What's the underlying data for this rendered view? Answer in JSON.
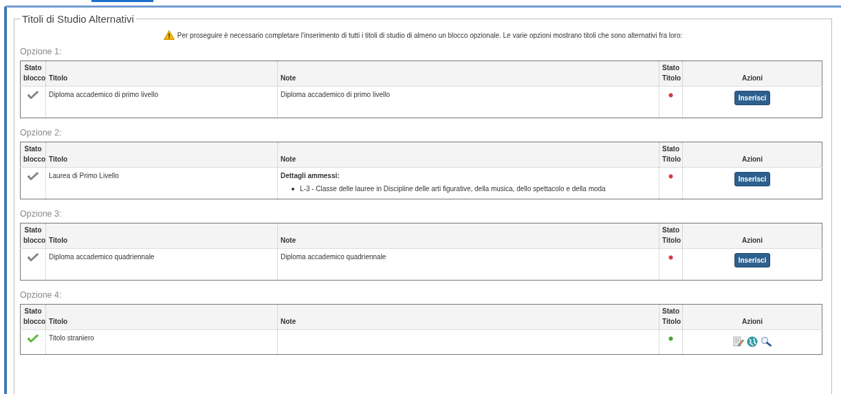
{
  "fieldset": {
    "legend": "Titoli di Studio Alternativi",
    "warning": "Per proseguire è necessario completare l'inserimento di tutti i titoli di studio di almeno un blocco opzionale. Le varie opzioni mostrano titoli che sono alternativi fra loro:"
  },
  "options": [
    {
      "label": "Opzione 1:",
      "columns": [
        "Stato blocco",
        "Titolo",
        "Note",
        "Stato Titolo",
        "Azioni"
      ],
      "block_done": false,
      "title": "Diploma accademico di primo livello",
      "note": {
        "kind": "text",
        "text": "Diploma accademico di primo livello"
      },
      "title_ok": false,
      "actions": {
        "kind": "button",
        "label": "Inserisci"
      }
    },
    {
      "label": "Opzione 2:",
      "columns": [
        "Stato blocco",
        "Titolo",
        "Note",
        "Stato Titolo",
        "Azioni"
      ],
      "block_done": false,
      "title": "Laurea di Primo Livello",
      "note": {
        "kind": "details",
        "heading": "Dettagli ammessi:",
        "items": [
          "L-3 - Classe delle lauree in Discipline delle arti figurative, della musica, dello spettacolo e della moda"
        ]
      },
      "title_ok": false,
      "actions": {
        "kind": "button",
        "label": "Inserisci"
      }
    },
    {
      "label": "Opzione 3:",
      "columns": [
        "Stato blocco",
        "Titolo",
        "Note",
        "Stato Titolo",
        "Azioni"
      ],
      "block_done": false,
      "title": "Diploma accademico quadriennale",
      "note": {
        "kind": "text",
        "text": "Diploma accademico quadriennale"
      },
      "title_ok": false,
      "actions": {
        "kind": "button",
        "label": "Inserisci"
      }
    },
    {
      "label": "Opzione 4:",
      "columns": [
        "Stato blocco",
        "Titolo",
        "Note",
        "Stato Titolo",
        "Azioni"
      ],
      "block_done": true,
      "title": "Titolo straniero",
      "title_ok": true,
      "actions": {
        "kind": "icons"
      }
    }
  ]
}
